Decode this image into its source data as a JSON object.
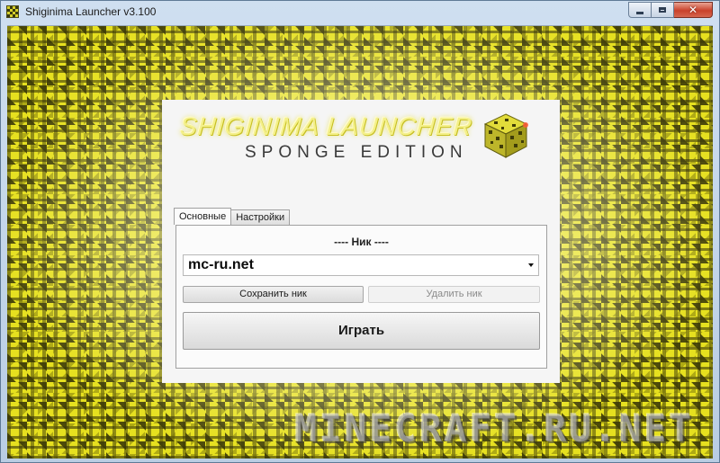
{
  "window": {
    "title": "Shiginima Launcher v3.100",
    "icon": "sponge-block-icon",
    "controls": {
      "minimize": "minimize-icon",
      "maximize": "maximize-icon",
      "close": "close-icon"
    }
  },
  "logo": {
    "line1": "SHIGINIMA LAUNCHER",
    "line2": "SPONGE EDITION",
    "cube_icon": "sponge-cube-icon"
  },
  "tabs": [
    {
      "label": "Основные",
      "active": true
    },
    {
      "label": "Настройки",
      "active": false
    }
  ],
  "main": {
    "nick_heading": "---- Ник ----",
    "nick_value": "mc-ru.net",
    "save_nick_label": "Сохранить ник",
    "delete_nick_label": "Удалить ник",
    "play_label": "Играть"
  },
  "watermark": "MINECRAFT.RU.NET",
  "colors": {
    "accent": "#e6e01f",
    "panel": "#f5f5f5"
  }
}
